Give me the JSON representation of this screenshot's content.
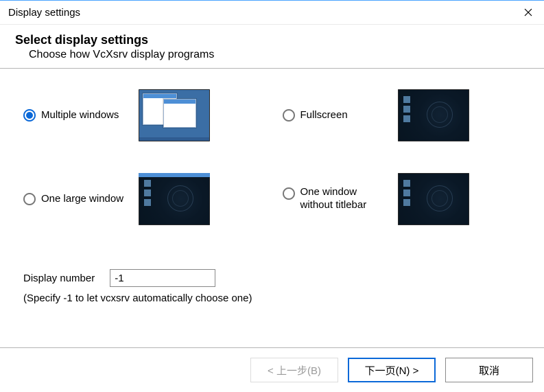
{
  "window": {
    "title": "Display settings"
  },
  "header": {
    "heading": "Select display settings",
    "subheading": "Choose how VcXsrv display programs"
  },
  "options": {
    "multiple_windows": {
      "label": "Multiple windows",
      "selected": true
    },
    "fullscreen": {
      "label": "Fullscreen",
      "selected": false
    },
    "one_large": {
      "label": "One large window",
      "selected": false
    },
    "one_no_titlebar": {
      "label": "One window without titlebar",
      "selected": false
    }
  },
  "display_number": {
    "label": "Display number",
    "value": "-1",
    "hint": "(Specify -1 to let vcxsrv automatically choose one)"
  },
  "footer": {
    "back": "< 上一步(B)",
    "next": "下一页(N) >",
    "cancel": "取消"
  }
}
